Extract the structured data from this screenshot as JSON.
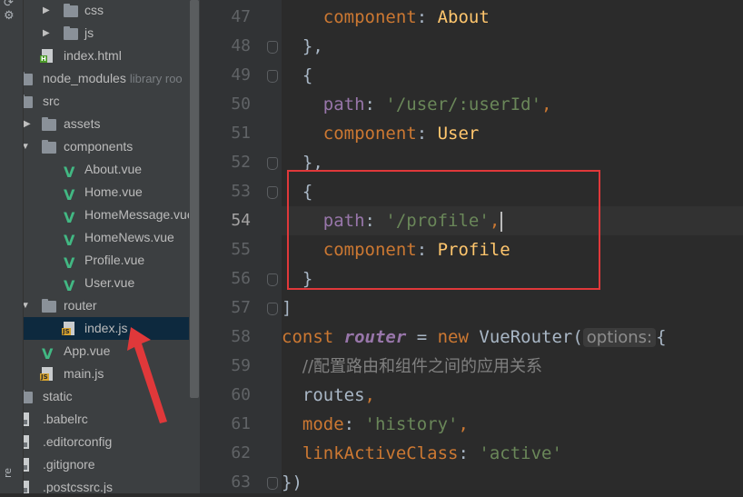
{
  "toolstrip": {
    "icons": [
      "sync-icon",
      "gear-icon"
    ],
    "vertical_label": "re"
  },
  "tree": {
    "rows": [
      {
        "label": "css",
        "icon": "folder-icon",
        "hint": ""
      },
      {
        "label": "js",
        "icon": "folder-icon",
        "hint": ""
      },
      {
        "label": "index.html",
        "icon": "html-file-icon",
        "hint": ""
      },
      {
        "label": "node_modules",
        "icon": "folder-icon",
        "hint": "library roo"
      },
      {
        "label": "src",
        "icon": "folder-icon",
        "hint": ""
      },
      {
        "label": "assets",
        "icon": "folder-icon",
        "hint": ""
      },
      {
        "label": "components",
        "icon": "folder-icon",
        "hint": ""
      },
      {
        "label": "About.vue",
        "icon": "vue-file-icon",
        "hint": ""
      },
      {
        "label": "Home.vue",
        "icon": "vue-file-icon",
        "hint": ""
      },
      {
        "label": "HomeMessage.vue",
        "icon": "vue-file-icon",
        "hint": ""
      },
      {
        "label": "HomeNews.vue",
        "icon": "vue-file-icon",
        "hint": ""
      },
      {
        "label": "Profile.vue",
        "icon": "vue-file-icon",
        "hint": ""
      },
      {
        "label": "User.vue",
        "icon": "vue-file-icon",
        "hint": ""
      },
      {
        "label": "router",
        "icon": "folder-icon",
        "hint": ""
      },
      {
        "label": "index.js",
        "icon": "js-file-icon",
        "hint": ""
      },
      {
        "label": "App.vue",
        "icon": "vue-file-icon",
        "hint": ""
      },
      {
        "label": "main.js",
        "icon": "js-file-icon",
        "hint": ""
      },
      {
        "label": "static",
        "icon": "folder-icon",
        "hint": ""
      },
      {
        "label": ".babelrc",
        "icon": "config-file-icon",
        "hint": ""
      },
      {
        "label": ".editorconfig",
        "icon": "config-file-icon",
        "hint": ""
      },
      {
        "label": ".gitignore",
        "icon": "config-file-icon",
        "hint": ""
      },
      {
        "label": ".postcssrc.js",
        "icon": "config-file-icon",
        "hint": ""
      }
    ],
    "selected": "index.js"
  },
  "editor": {
    "current_line": 54,
    "lines": [
      {
        "n": "47",
        "t": [
          [
            "",
            "    "
          ],
          [
            "k",
            "component"
          ],
          [
            "",
            ": "
          ],
          [
            "f",
            "About"
          ]
        ]
      },
      {
        "n": "48",
        "t": [
          [
            "",
            "  "
          ],
          [
            "",
            "},"
          ]
        ]
      },
      {
        "n": "49",
        "t": [
          [
            "",
            "  "
          ],
          [
            "",
            "{"
          ]
        ]
      },
      {
        "n": "50",
        "t": [
          [
            "",
            "    "
          ],
          [
            "p",
            "path"
          ],
          [
            "",
            ": "
          ],
          [
            "s",
            "'/user/:userId'"
          ],
          [
            "k",
            ","
          ]
        ]
      },
      {
        "n": "51",
        "t": [
          [
            "",
            "    "
          ],
          [
            "k",
            "component"
          ],
          [
            "",
            ": "
          ],
          [
            "f",
            "User"
          ]
        ]
      },
      {
        "n": "52",
        "t": [
          [
            "",
            "  "
          ],
          [
            "",
            "},"
          ]
        ]
      },
      {
        "n": "53",
        "t": [
          [
            "",
            "  "
          ],
          [
            "",
            "{"
          ]
        ]
      },
      {
        "n": "54",
        "t": [
          [
            "",
            "    "
          ],
          [
            "p",
            "path"
          ],
          [
            "",
            ": "
          ],
          [
            "s",
            "'/profile'"
          ],
          [
            "k",
            ","
          ]
        ]
      },
      {
        "n": "55",
        "t": [
          [
            "",
            "    "
          ],
          [
            "k",
            "component"
          ],
          [
            "",
            ": "
          ],
          [
            "f",
            "Profile"
          ]
        ]
      },
      {
        "n": "56",
        "t": [
          [
            "",
            "  "
          ],
          [
            "",
            "}"
          ]
        ]
      },
      {
        "n": "57",
        "t": [
          [
            "",
            "]"
          ]
        ]
      },
      {
        "n": "58",
        "t": [
          [
            "k",
            "const "
          ],
          [
            "v",
            "router"
          ],
          [
            "",
            " = "
          ],
          [
            "k",
            "new "
          ],
          [
            "",
            "VueRouter("
          ],
          [
            "inlay",
            "options:"
          ],
          [
            "",
            "{"
          ]
        ]
      },
      {
        "n": "59",
        "t": [
          [
            "",
            "  "
          ],
          [
            "cm",
            "//配置路由和组件之间的应用关系"
          ]
        ]
      },
      {
        "n": "60",
        "t": [
          [
            "",
            "  "
          ],
          [
            "",
            "routes"
          ],
          [
            "k",
            ","
          ]
        ]
      },
      {
        "n": "61",
        "t": [
          [
            "",
            "  "
          ],
          [
            "k",
            "mode"
          ],
          [
            "",
            ": "
          ],
          [
            "s",
            "'history'"
          ],
          [
            "k",
            ","
          ]
        ]
      },
      {
        "n": "62",
        "t": [
          [
            "",
            "  "
          ],
          [
            "k",
            "linkActiveClass"
          ],
          [
            "",
            ": "
          ],
          [
            "s",
            "'active'"
          ]
        ]
      },
      {
        "n": "63",
        "t": [
          [
            "",
            "})"
          ]
        ]
      }
    ]
  },
  "colors": {
    "highlight_box": "#e0383a",
    "arrow": "#e0383a",
    "selection": "#0d293e",
    "vue_green": "#42b883"
  }
}
